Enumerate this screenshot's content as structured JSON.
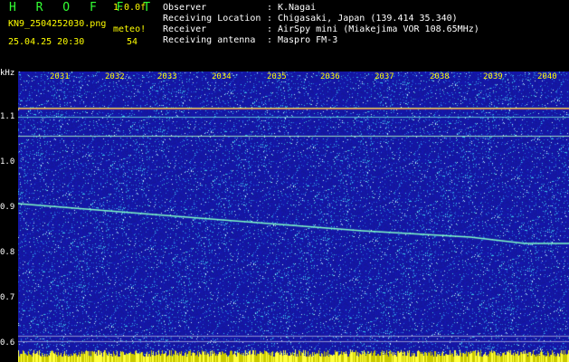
{
  "header": {
    "title": "H R O F F T",
    "version": "1.0.0f",
    "filename": "KN9_2504252030.png",
    "datetime": "25.04.25 20:30",
    "meteo_label": "meteo!",
    "meteo_count": "54"
  },
  "info": [
    {
      "label": "Observer",
      "value": "K.Nagai"
    },
    {
      "label": "Receiving Location",
      "value": "Chigasaki, Japan (139.414 35.340)"
    },
    {
      "label": "Receiver",
      "value": "AirSpy mini (Miakejima VOR 108.65MHz)"
    },
    {
      "label": "Receiving antenna",
      "value": "Maspro FM-3"
    }
  ],
  "separator": ":",
  "axis": {
    "y_unit": "kHz",
    "y_ticks": [
      "1.1",
      "1.0",
      "0.9",
      "0.8",
      "0.7",
      "0.6"
    ],
    "x_ticks": [
      "2031",
      "2032",
      "2033",
      "2034",
      "2035",
      "2036",
      "2037",
      "2038",
      "2039",
      "2040"
    ]
  },
  "colors": {
    "background": "#1a1aa0",
    "text_yellow": "#ffff00",
    "text_white": "#ffffff",
    "trace": "#7fffd4",
    "carrier": "#ffff66"
  }
}
